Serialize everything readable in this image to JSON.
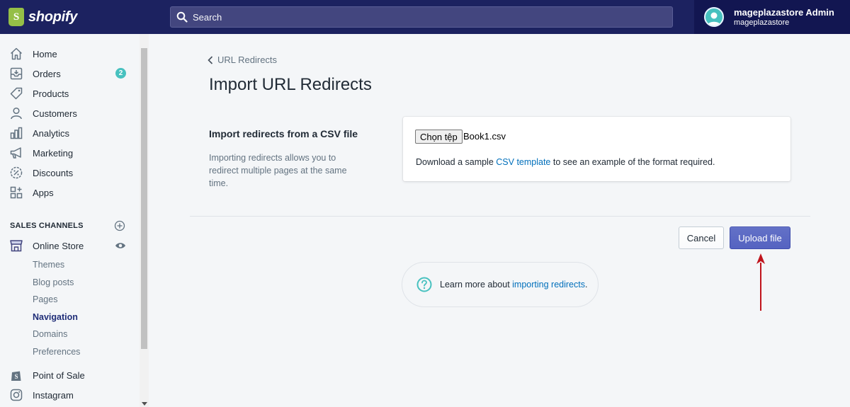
{
  "topbar": {
    "logo_text": "shopify",
    "search_placeholder": "Search",
    "user_name": "mageplazastore Admin",
    "user_store": "mageplazastore"
  },
  "sidebar": {
    "items": [
      {
        "label": "Home",
        "icon": "home-icon"
      },
      {
        "label": "Orders",
        "icon": "orders-icon",
        "badge": "2"
      },
      {
        "label": "Products",
        "icon": "tag-icon"
      },
      {
        "label": "Customers",
        "icon": "person-icon"
      },
      {
        "label": "Analytics",
        "icon": "bar-chart-icon"
      },
      {
        "label": "Marketing",
        "icon": "megaphone-icon"
      },
      {
        "label": "Discounts",
        "icon": "discount-icon"
      },
      {
        "label": "Apps",
        "icon": "apps-icon"
      }
    ],
    "sales_channels_title": "SALES CHANNELS",
    "online_store": "Online Store",
    "sub_items": [
      "Themes",
      "Blog posts",
      "Pages",
      "Navigation",
      "Domains",
      "Preferences"
    ],
    "active_sub_item": "Navigation",
    "point_of_sale": "Point of Sale",
    "instagram": "Instagram"
  },
  "main": {
    "breadcrumb": "URL Redirects",
    "title": "Import URL Redirects",
    "section_heading": "Import redirects from a CSV file",
    "section_description": "Importing redirects allows you to redirect multiple pages at the same time.",
    "file_button": "Chọn tệp",
    "file_name": "Book1.csv",
    "download_prefix": "Download a sample ",
    "download_link": "CSV template",
    "download_suffix": " to see an example of the format required.",
    "cancel_label": "Cancel",
    "upload_label": "Upload file",
    "help_prefix": "Learn more about ",
    "help_link": "importing redirects",
    "help_suffix": "."
  },
  "colors": {
    "topbar": "#1c2260",
    "primary": "#5c6ac4",
    "link": "#006fbb",
    "badge": "#47c1bf",
    "annotation_arrow": "#c0141c"
  }
}
